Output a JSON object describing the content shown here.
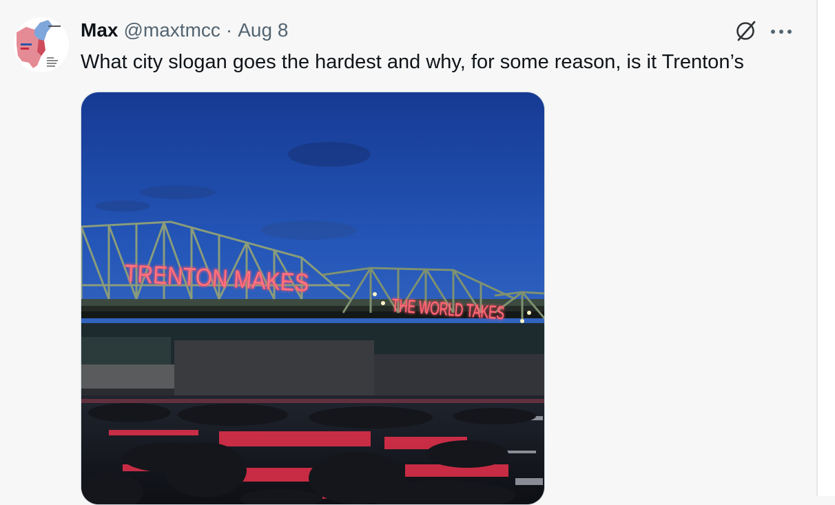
{
  "tweet": {
    "author_name": "Max",
    "handle": "@maxtmcc",
    "separator": "·",
    "date": "Aug 8",
    "text": "What city slogan goes the hardest and why, for some reason, is it Trenton’s"
  },
  "icons": {
    "grok": "grok-slash-circle-icon",
    "more": "more-horizontal-icon"
  },
  "media": {
    "sign_left": "TRENTON MAKES",
    "sign_right": "THE WORLD TAKES"
  },
  "colors": {
    "name": "#0f1419",
    "secondary": "#536471",
    "background": "#f7f7f7",
    "neon": "#ff5a6e"
  }
}
